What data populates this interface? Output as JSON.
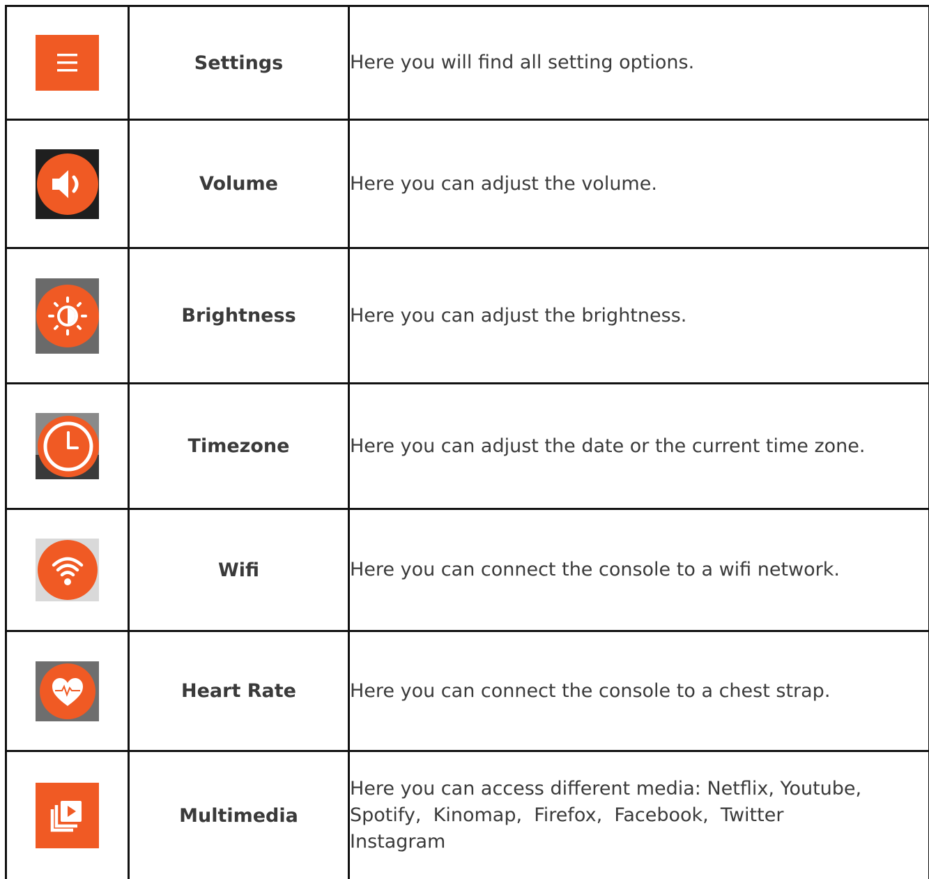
{
  "colors": {
    "accent": "#f05a24",
    "border": "#111111",
    "text": "#3a3a3a",
    "icon_dark_bg": "#1f1f1f",
    "icon_gray_bg": "#6e6e6e",
    "icon_light_bg": "#d9d9d9"
  },
  "rows": [
    {
      "icon": "menu-icon",
      "name": "Settings",
      "description": "Here you will find all setting options."
    },
    {
      "icon": "volume-icon",
      "name": "Volume",
      "description": "Here you can adjust the volume."
    },
    {
      "icon": "brightness-icon",
      "name": "Brightness",
      "description": "Here you can adjust the brightness."
    },
    {
      "icon": "clock-icon",
      "name": "Timezone",
      "description": "Here you can adjust the date or the current time zone."
    },
    {
      "icon": "wifi-icon",
      "name": "Wifi",
      "description": "Here you can connect the console to a wifi network."
    },
    {
      "icon": "heart-rate-icon",
      "name": "Heart Rate",
      "description": "Here you can connect the console to a chest strap."
    },
    {
      "icon": "multimedia-icon",
      "name": "Multimedia",
      "description_lines": [
        "Here you can access different media: Netflix, Youtube,",
        "Spotify,  Kinomap,  Firefox,  Facebook,  Twitter",
        "Instagram"
      ]
    }
  ]
}
